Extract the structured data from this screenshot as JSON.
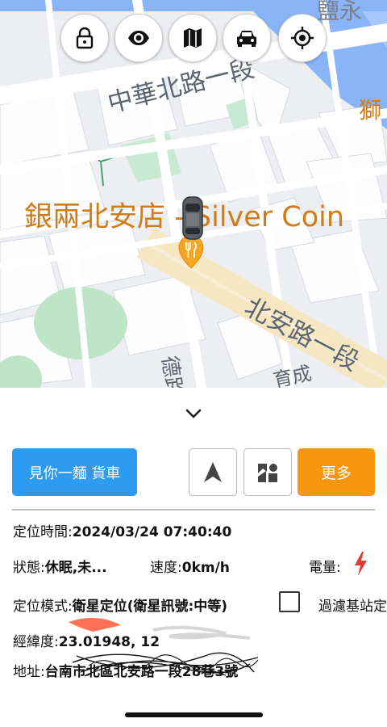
{
  "map": {
    "road_labels": [
      "中華北路一段",
      "北安路一段",
      "德路",
      "育成"
    ],
    "district_labels": [
      "鹽永",
      "獅"
    ],
    "poi_label": "銀兩北安店 - Silver Coin"
  },
  "toolbar": {
    "icons": [
      "lock-icon",
      "eye-icon",
      "map-icon",
      "car-icon",
      "crosshair-icon"
    ]
  },
  "actions": {
    "primary_label": "見你一麵 貨車",
    "more_label": "更多"
  },
  "info": {
    "time_label": "定位時間:",
    "time_value": "2024/03/24 07:40:40",
    "status_label": "狀態:",
    "status_value": "休眠,未...",
    "speed_label": "速度:",
    "speed_value": "0km/h",
    "battery_label": "電量:",
    "mode_label": "定位模式:",
    "mode_value": "衛星定位(衛星訊號:中等)",
    "filter_label": "過濾基站定",
    "coords_label": "經緯度:",
    "coords_value": "23.01948, 12",
    "address_label": "地址:",
    "address_value": "台南市北區北安路一段28巷3號"
  },
  "colors": {
    "primary": "#2d9bf0",
    "more": "#f7960f",
    "battery": "#e53935",
    "poi": "#d17c1a"
  }
}
